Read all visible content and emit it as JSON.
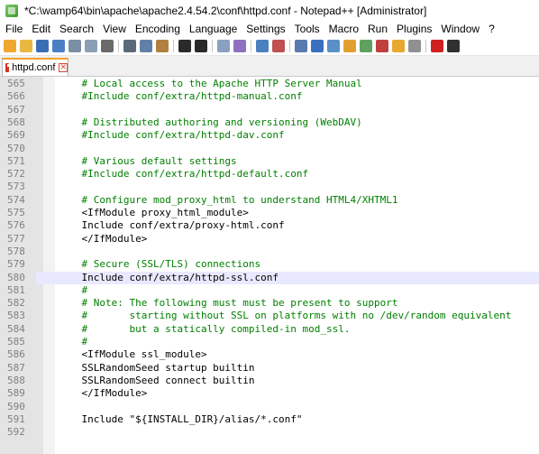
{
  "window": {
    "title": "*C:\\wamp64\\bin\\apache\\apache2.4.54.2\\conf\\httpd.conf - Notepad++ [Administrator]"
  },
  "menu": [
    "File",
    "Edit",
    "Search",
    "View",
    "Encoding",
    "Language",
    "Settings",
    "Tools",
    "Macro",
    "Run",
    "Plugins",
    "Window",
    "?"
  ],
  "toolbar": {
    "buttons": [
      {
        "name": "new-file-icon",
        "color": "#f0a830"
      },
      {
        "name": "open-file-icon",
        "color": "#e8b840"
      },
      {
        "name": "save-icon",
        "color": "#3a6fb5"
      },
      {
        "name": "save-all-icon",
        "color": "#4a7fc5"
      },
      {
        "name": "close-icon",
        "color": "#7a8fa5"
      },
      {
        "name": "close-all-icon",
        "color": "#8a9fb5"
      },
      {
        "name": "print-icon",
        "color": "#6a6a6a"
      },
      {
        "sep": true
      },
      {
        "name": "cut-icon",
        "color": "#5a6a7a"
      },
      {
        "name": "copy-icon",
        "color": "#6080a8"
      },
      {
        "name": "paste-icon",
        "color": "#b08040"
      },
      {
        "sep": true
      },
      {
        "name": "undo-icon",
        "color": "#2a2a2a"
      },
      {
        "name": "redo-icon",
        "color": "#2a2a2a"
      },
      {
        "sep": true
      },
      {
        "name": "find-icon",
        "color": "#8aa0c0"
      },
      {
        "name": "replace-icon",
        "color": "#9070c0"
      },
      {
        "sep": true
      },
      {
        "name": "zoom-in-icon",
        "color": "#4a80c0"
      },
      {
        "name": "zoom-out-icon",
        "color": "#c05050"
      },
      {
        "sep": true
      },
      {
        "name": "sync-vertical-icon",
        "color": "#5a7ab0"
      },
      {
        "name": "show-all-chars-icon",
        "color": "#3a70c0"
      },
      {
        "name": "indent-guide-icon",
        "color": "#5a90c8"
      },
      {
        "name": "word-wrap-icon",
        "color": "#e0a030"
      },
      {
        "name": "doc-map-icon",
        "color": "#60a060"
      },
      {
        "name": "function-list-icon",
        "color": "#c04040"
      },
      {
        "name": "folder-workspace-icon",
        "color": "#e8a830"
      },
      {
        "name": "monitor-icon",
        "color": "#909090"
      },
      {
        "sep": true
      },
      {
        "name": "record-macro-icon",
        "color": "#d02020"
      },
      {
        "name": "stop-macro-icon",
        "color": "#303030"
      }
    ]
  },
  "tab": {
    "label": "httpd.conf",
    "close_symbol": "✕"
  },
  "editor": {
    "lines": [
      {
        "n": "565",
        "text": "    # Local access to the Apache HTTP Server Manual",
        "type": "comment"
      },
      {
        "n": "566",
        "text": "    #Include conf/extra/httpd-manual.conf",
        "type": "comment"
      },
      {
        "n": "567",
        "text": "",
        "type": "code"
      },
      {
        "n": "568",
        "text": "    # Distributed authoring and versioning (WebDAV)",
        "type": "comment"
      },
      {
        "n": "569",
        "text": "    #Include conf/extra/httpd-dav.conf",
        "type": "comment"
      },
      {
        "n": "570",
        "text": "",
        "type": "code"
      },
      {
        "n": "571",
        "text": "    # Various default settings",
        "type": "comment"
      },
      {
        "n": "572",
        "text": "    #Include conf/extra/httpd-default.conf",
        "type": "comment"
      },
      {
        "n": "573",
        "text": "",
        "type": "code"
      },
      {
        "n": "574",
        "text": "    # Configure mod_proxy_html to understand HTML4/XHTML1",
        "type": "comment"
      },
      {
        "n": "575",
        "text": "    <IfModule proxy_html_module>",
        "type": "code"
      },
      {
        "n": "576",
        "text": "    Include conf/extra/proxy-html.conf",
        "type": "code"
      },
      {
        "n": "577",
        "text": "    </IfModule>",
        "type": "code"
      },
      {
        "n": "578",
        "text": "",
        "type": "code"
      },
      {
        "n": "579",
        "text": "    # Secure (SSL/TLS) connections",
        "type": "comment"
      },
      {
        "n": "580",
        "text": "    Include conf/extra/httpd-ssl.conf",
        "type": "code",
        "current": true
      },
      {
        "n": "581",
        "text": "    #",
        "type": "comment"
      },
      {
        "n": "582",
        "text": "    # Note: The following must must be present to support",
        "type": "comment"
      },
      {
        "n": "583",
        "text": "    #       starting without SSL on platforms with no /dev/random equivalent",
        "type": "comment"
      },
      {
        "n": "584",
        "text": "    #       but a statically compiled-in mod_ssl.",
        "type": "comment"
      },
      {
        "n": "585",
        "text": "    #",
        "type": "comment"
      },
      {
        "n": "586",
        "text": "    <IfModule ssl_module>",
        "type": "code"
      },
      {
        "n": "587",
        "text": "    SSLRandomSeed startup builtin",
        "type": "code"
      },
      {
        "n": "588",
        "text": "    SSLRandomSeed connect builtin",
        "type": "code"
      },
      {
        "n": "589",
        "text": "    </IfModule>",
        "type": "code"
      },
      {
        "n": "590",
        "text": "",
        "type": "code"
      },
      {
        "n": "591",
        "text": "    Include \"${INSTALL_DIR}/alias/*.conf\"",
        "type": "code"
      },
      {
        "n": "592",
        "text": "",
        "type": "code"
      }
    ]
  }
}
